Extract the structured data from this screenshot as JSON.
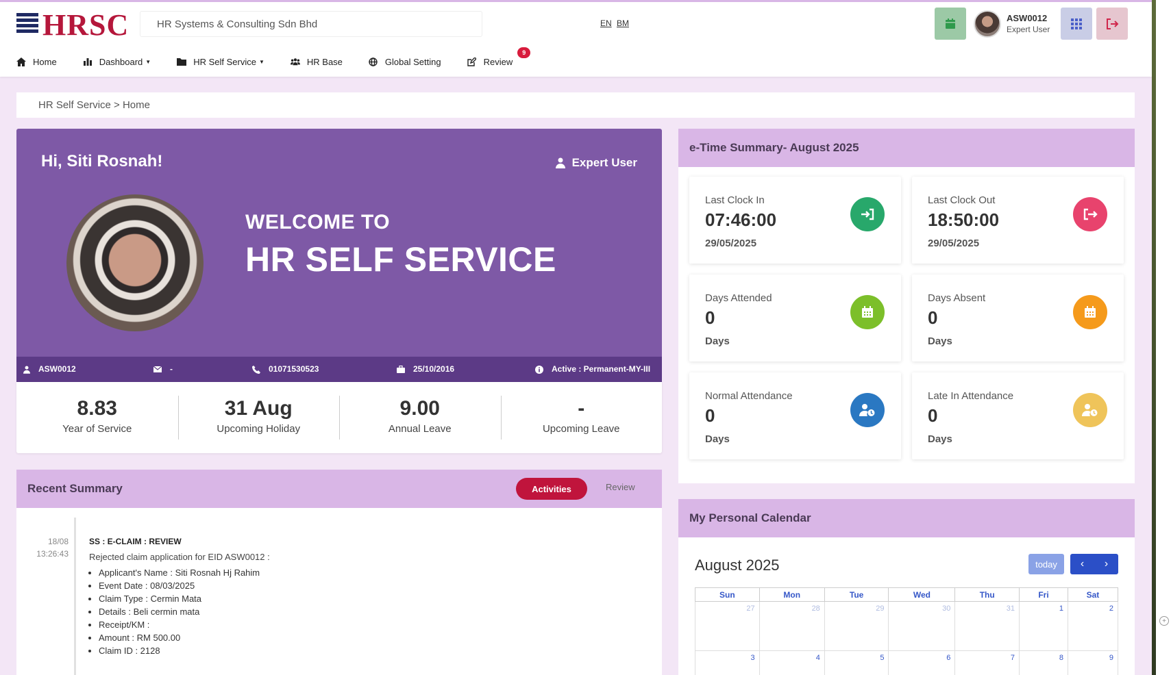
{
  "header": {
    "logo_text": "HRSC",
    "company": "HR Systems & Consulting Sdn Bhd",
    "lang_en": "EN",
    "lang_bm": "BM",
    "user_id": "ASW0012",
    "user_role": "Expert User"
  },
  "nav": {
    "home": "Home",
    "dashboard": "Dashboard",
    "hr_self_service": "HR Self Service",
    "hr_base": "HR Base",
    "global_setting": "Global Setting",
    "review": "Review",
    "review_badge": "9"
  },
  "breadcrumb": "HR Self Service > Home",
  "welcome": {
    "greeting": "Hi, Siti Rosnah!",
    "role": "Expert User",
    "welcome_to": "WELCOME TO",
    "title": "HR SELF SERVICE"
  },
  "info_strip": {
    "employee_id": "ASW0012",
    "email": "-",
    "phone": "01071530523",
    "join_date": "25/10/2016",
    "status": "Active : Permanent-MY-III"
  },
  "stats": [
    {
      "value": "8.83",
      "label": "Year of Service"
    },
    {
      "value": "31 Aug",
      "label": "Upcoming Holiday"
    },
    {
      "value": "9.00",
      "label": "Annual Leave"
    },
    {
      "value": "-",
      "label": "Upcoming Leave"
    }
  ],
  "recent": {
    "title": "Recent Summary",
    "tab_activities": "Activities",
    "tab_review": "Review",
    "item": {
      "date": "18/08",
      "time": "13:26:43",
      "title": "SS : E-CLAIM : REVIEW",
      "desc": "Rejected claim application for EID ASW0012 :",
      "details": [
        "Applicant's Name : Siti Rosnah Hj Rahim",
        "Event Date : 08/03/2025",
        "Claim Type : Cermin Mata",
        "Details : Beli cermin mata",
        "Receipt/KM :",
        "Amount : RM 500.00",
        "Claim ID : 2128"
      ]
    }
  },
  "etime": {
    "title": "e-Time Summary- August 2025",
    "cards": [
      {
        "label": "Last Clock In",
        "value": "07:46:00",
        "sub": "29/05/2025",
        "color": "#28a86b"
      },
      {
        "label": "Last Clock Out",
        "value": "18:50:00",
        "sub": "29/05/2025",
        "color": "#e8436d"
      },
      {
        "label": "Days Attended",
        "value": "0",
        "sub": "Days",
        "color": "#7cbf2a"
      },
      {
        "label": "Days Absent",
        "value": "0",
        "sub": "Days",
        "color": "#f59a1b"
      },
      {
        "label": "Normal Attendance",
        "value": "0",
        "sub": "Days",
        "color": "#2a78c2"
      },
      {
        "label": "Late In Attendance",
        "value": "0",
        "sub": "Days",
        "color": "#efc45a"
      }
    ]
  },
  "calendar": {
    "title": "My Personal Calendar",
    "month": "August 2025",
    "today": "today",
    "days": [
      "Sun",
      "Mon",
      "Tue",
      "Wed",
      "Thu",
      "Fri",
      "Sat"
    ],
    "week1": [
      "27",
      "28",
      "29",
      "30",
      "31",
      "1",
      "2"
    ],
    "week2": [
      "3",
      "4",
      "5",
      "6",
      "7",
      "8",
      "9"
    ]
  },
  "colors": {
    "purple": "#7e59a6",
    "purple_dark": "#5c3a86",
    "panel_head": "#d9b6e6",
    "accent_red": "#c0143c"
  }
}
